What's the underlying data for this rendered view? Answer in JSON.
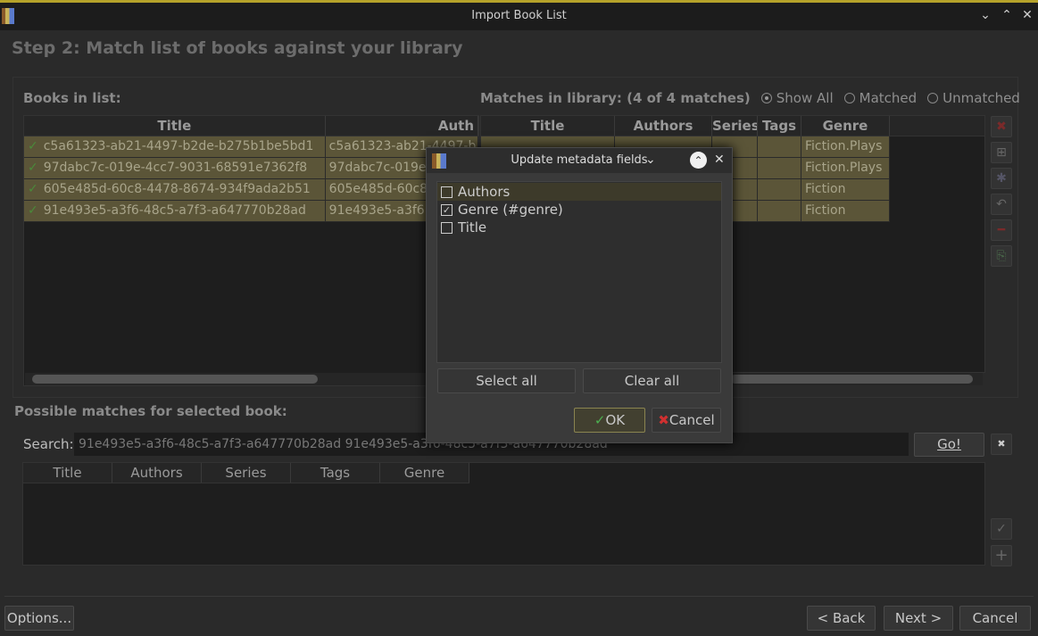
{
  "window": {
    "title": "Import Book List",
    "icon": "calibre-books-icon"
  },
  "heading": "Step 2: Match list of books against your library",
  "books_in_list": {
    "label": "Books in list:",
    "columns": [
      "Title",
      "Auth"
    ],
    "rows": [
      [
        "c5a61323-ab21-4497-b2de-b275b1be5bd1",
        "c5a61323-ab21-4497-b"
      ],
      [
        "97dabc7c-019e-4cc7-9031-68591e7362f8",
        "97dabc7c-019e"
      ],
      [
        "605e485d-60c8-4478-8674-934f9ada2b51",
        "605e485d-60c8"
      ],
      [
        "91e493e5-a3f6-48c5-a7f3-a647770b28ad",
        "91e493e5-a3f6"
      ]
    ]
  },
  "matches": {
    "label": "Matches in library: (4 of 4 matches)",
    "filters": [
      {
        "label": "Show All",
        "selected": true
      },
      {
        "label": "Matched",
        "selected": false
      },
      {
        "label": "Unmatched",
        "selected": false
      }
    ],
    "columns": [
      "Title",
      "Authors",
      "Series",
      "Tags",
      "Genre"
    ],
    "genres": [
      "Fiction.Plays",
      "Fiction.Plays",
      "Fiction",
      "Fiction"
    ]
  },
  "side_buttons": [
    "remove-icon",
    "add-book-icon",
    "clear-match-icon",
    "undo-icon",
    "minus-icon",
    "export-icon"
  ],
  "possible": {
    "label": "Possible matches for selected book:",
    "search_label": "Search:",
    "search_value": "91e493e5-a3f6-48c5-a7f3-a647770b28ad 91e493e5-a3f6-48c5-a7f3-a647770b28ad",
    "go": "Go!",
    "columns": [
      "Title",
      "Authors",
      "Series",
      "Tags",
      "Genre"
    ]
  },
  "footer": {
    "options": "Options...",
    "back": "< Back",
    "next": "Next >",
    "cancel": "Cancel"
  },
  "dialog": {
    "title": "Update metadata fields",
    "fields": [
      {
        "label": "Authors",
        "checked": false
      },
      {
        "label": "Genre (#genre)",
        "checked": true
      },
      {
        "label": "Title",
        "checked": false
      }
    ],
    "select_all": "Select all",
    "clear_all": "Clear all",
    "ok": "OK",
    "cancel": "Cancel"
  }
}
